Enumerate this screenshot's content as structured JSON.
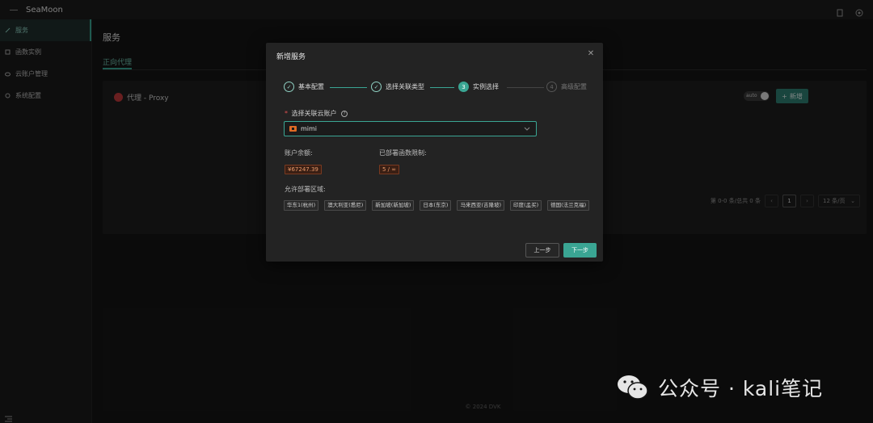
{
  "app": {
    "brand": "SeaMoon"
  },
  "sidebar": {
    "items": [
      {
        "label": "服务",
        "icon": "leaf-icon",
        "active": true
      },
      {
        "label": "函数实例",
        "icon": "function-icon",
        "active": false
      },
      {
        "label": "云账户管理",
        "icon": "cloud-icon",
        "active": false
      },
      {
        "label": "系统配置",
        "icon": "gear-icon",
        "active": false
      }
    ]
  },
  "main": {
    "title": "服务",
    "tab": "正向代理",
    "card": {
      "title": "代理 - Proxy",
      "toggle_label": "auto",
      "add_label": "新增"
    },
    "pager": {
      "summary": "第 0-0 条/总共 0 条",
      "current_page": "1",
      "page_size": "12 条/页"
    },
    "footer": "© 2024 DVK"
  },
  "modal": {
    "title": "新增服务",
    "steps": [
      {
        "num": "1",
        "label": "基本配置",
        "state": "done"
      },
      {
        "num": "2",
        "label": "选择关联类型",
        "state": "done"
      },
      {
        "num": "3",
        "label": "实例选择",
        "state": "current"
      },
      {
        "num": "4",
        "label": "高级配置",
        "state": "pending"
      }
    ],
    "account_label": "选择关联云账户",
    "account_value": "mimi",
    "balance_label": "账户余额:",
    "balance_value": "¥67247.39",
    "limit_label": "已部署函数限制:",
    "limit_value": "5 / ∞",
    "regions_label": "允许部署区域:",
    "regions": [
      "华东1(杭州)",
      "澳大利亚(悉尼)",
      "新加坡(新加坡)",
      "日本(东京)",
      "马来西亚(吉隆坡)",
      "印度(孟买)",
      "德国(法兰克福)"
    ],
    "prev_label": "上一步",
    "next_label": "下一步"
  },
  "watermark": {
    "text": "公众号 · kali笔记"
  },
  "colors": {
    "accent": "#3aa593",
    "danger": "#c0393b",
    "bg": "#151515"
  }
}
